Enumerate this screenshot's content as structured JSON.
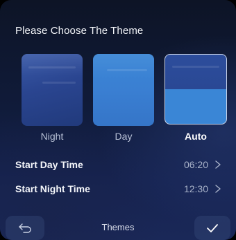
{
  "header": {
    "title": "Please Choose The Theme"
  },
  "themes": [
    {
      "label": "Night",
      "selected": false
    },
    {
      "label": "Day",
      "selected": false
    },
    {
      "label": "Auto",
      "selected": true
    }
  ],
  "settings": {
    "start_day": {
      "label": "Start Day Time",
      "value": "06:20"
    },
    "start_night": {
      "label": "Start Night Time",
      "value": "12:30"
    }
  },
  "footer": {
    "title": "Themes",
    "back_icon": "return-arrow-icon",
    "confirm_icon": "checkmark-icon"
  },
  "colors": {
    "background": "#111a38",
    "night_thumb": "#2a4590",
    "day_thumb": "#3a7fd2",
    "selected_border": "#c9d3e8",
    "text_primary": "#ffffff",
    "text_secondary": "#a9b3c9"
  }
}
